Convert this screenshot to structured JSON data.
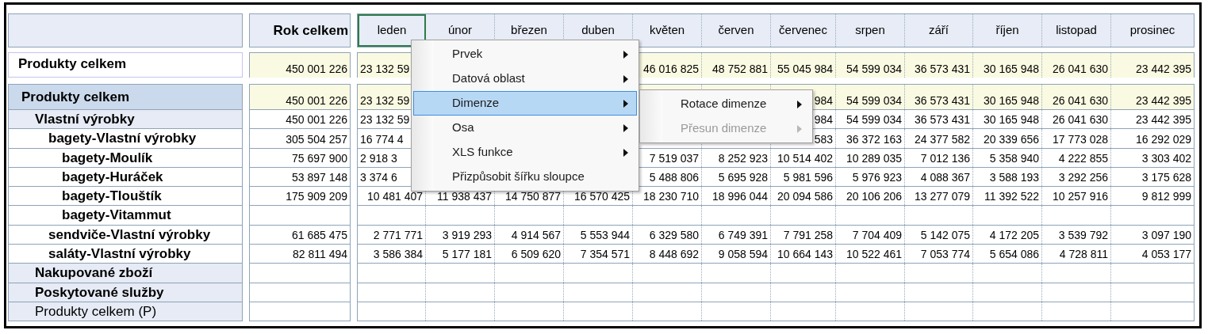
{
  "table": {
    "total_header": "Rok celkem",
    "columns": [
      {
        "label": "leden",
        "selected": true
      },
      {
        "label": "únor",
        "selected": false
      },
      {
        "label": "březen",
        "selected": false
      },
      {
        "label": "duben",
        "selected": false
      },
      {
        "label": "květen",
        "selected": false
      },
      {
        "label": "červen",
        "selected": false
      },
      {
        "label": "červenec",
        "selected": false
      },
      {
        "label": "srpen",
        "selected": false
      },
      {
        "label": "září",
        "selected": false
      },
      {
        "label": "říjen",
        "selected": false
      },
      {
        "label": "listopad",
        "selected": false
      },
      {
        "label": "prosinec",
        "selected": false
      }
    ],
    "summary": {
      "label": "Produkty celkem",
      "total": "450 001 226",
      "cells": [
        {
          "text": "23 132 59",
          "cut": true
        },
        null,
        null,
        null,
        "46 016 825",
        "48 752 881",
        "55 045 984",
        "54 599 034",
        "36 573 431",
        "30 165 948",
        "26 041 630",
        "23 442 395"
      ]
    },
    "rows": [
      {
        "label": "Produkty celkem",
        "bold": true,
        "total": "450 001 226",
        "cells": [
          {
            "text": "23 132 59",
            "cut": true
          },
          null,
          null,
          null,
          null,
          null,
          "984",
          "54 599 034",
          "36 573 431",
          "30 165 948",
          "26 041 630",
          "23 442 395"
        ],
        "children": [
          {
            "label": "Vlastní výrobky",
            "bold": true,
            "total": "450 001 226",
            "cells": [
              {
                "text": "23 132 59",
                "cut": true
              },
              null,
              null,
              null,
              null,
              null,
              "984",
              "54 599 034",
              "36 573 431",
              "30 165 948",
              "26 041 630",
              "23 442 395"
            ],
            "children": [
              {
                "label": "bagety-Vlastní výrobky",
                "bold": true,
                "total": "305 504 257",
                "cells": [
                  {
                    "text": "16 774 4",
                    "cut": true
                  },
                  null,
                  null,
                  null,
                  null,
                  null,
                  "583",
                  "36 372 163",
                  "24 377 582",
                  "20 339 656",
                  "17 773 028",
                  "16 292 029"
                ],
                "children": [
                  {
                    "label": "bagety-Moulík",
                    "bold": true,
                    "total": "75 697 900",
                    "cells": [
                      {
                        "text": "2 918 3",
                        "cut": true
                      },
                      null,
                      null,
                      null,
                      "7 519 037",
                      "8 252 923",
                      "10 514 402",
                      "10 289 035",
                      "7 012 136",
                      "5 358 940",
                      "4 222 855",
                      "3 303 402"
                    ]
                  },
                  {
                    "label": "bagety-Huráček",
                    "bold": true,
                    "total": "53 897 148",
                    "cells": [
                      {
                        "text": "3 374 6",
                        "cut": true
                      },
                      null,
                      null,
                      null,
                      "5 488 806",
                      "5 695 928",
                      "5 981 596",
                      "5 976 923",
                      "4 088 367",
                      "3 588 193",
                      "3 292 256",
                      "3 175 628"
                    ]
                  },
                  {
                    "label": "bagety-Tlouštík",
                    "bold": true,
                    "total": "175 909 209",
                    "cells": [
                      "10 481 407",
                      "11 938 437",
                      "14 750 877",
                      "16 570 425",
                      "18 230 710",
                      "18 996 044",
                      "20 094 586",
                      "20 106 206",
                      "13 277 079",
                      "11 392 522",
                      "10 257 916",
                      "9 812 999"
                    ]
                  },
                  {
                    "label": "bagety-Vitammut",
                    "bold": true
                  }
                ]
              },
              {
                "label": "sendviče-Vlastní výrobky",
                "bold": true,
                "total": "61 685 475",
                "cells": [
                  "2 771 771",
                  "3 919 293",
                  "4 914 567",
                  "5 553 944",
                  "6 329 580",
                  "6 749 391",
                  "7 791 258",
                  "7 704 409",
                  "5 142 075",
                  "4 172 205",
                  "3 539 792",
                  "3 097 190"
                ]
              },
              {
                "label": "saláty-Vlastní výrobky",
                "bold": true,
                "total": "82 811 494",
                "cells": [
                  "3 586 384",
                  "5 177 181",
                  "6 509 620",
                  "7 354 571",
                  "8 448 692",
                  "9 058 594",
                  "10 664 143",
                  "10 522 461",
                  "7 053 774",
                  "5 654 086",
                  "4 728 811",
                  "4 053 177"
                ]
              }
            ]
          },
          {
            "label": "Nakupované zboží",
            "bold": true
          },
          {
            "label": "Poskytované služby",
            "bold": true
          },
          {
            "label": "Produkty celkem (P)",
            "bold": false
          }
        ]
      }
    ]
  },
  "context_menu": {
    "items": [
      {
        "label": "Prvek",
        "submenu": true,
        "selected": false,
        "disabled": false
      },
      {
        "label": "Datová oblast",
        "submenu": true,
        "selected": false,
        "disabled": false
      },
      {
        "label": "Dimenze",
        "submenu": true,
        "selected": true,
        "disabled": false
      },
      {
        "label": "Osa",
        "submenu": true,
        "selected": false,
        "disabled": false
      },
      {
        "label": "XLS funkce",
        "submenu": true,
        "selected": false,
        "disabled": false
      },
      {
        "label": "Přizpůsobit šířku sloupce",
        "submenu": false,
        "selected": false,
        "disabled": false
      }
    ],
    "submenu_items": [
      {
        "label": "Rotace dimenze",
        "submenu": true,
        "selected": false,
        "disabled": false
      },
      {
        "label": "Přesun dimenze",
        "submenu": true,
        "selected": false,
        "disabled": true
      }
    ]
  }
}
